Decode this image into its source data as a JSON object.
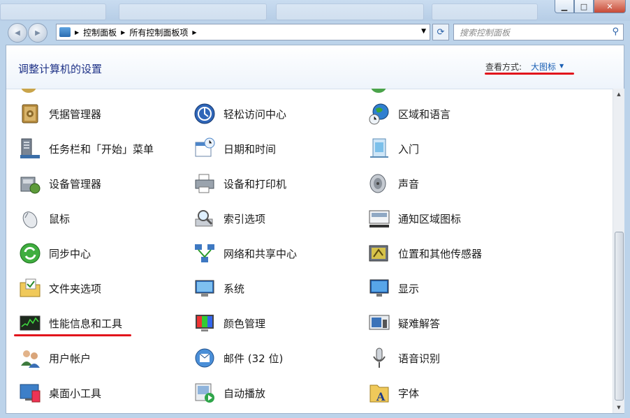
{
  "window": {
    "buttons": {
      "minimize": "▁",
      "maximize": "□",
      "close": "✕"
    }
  },
  "nav": {
    "back_icon": "◀",
    "forward_icon": "▶",
    "breadcrumb": [
      "控制面板",
      "所有控制面板项"
    ],
    "separator": "▶",
    "dropdown_icon": "▼",
    "refresh_icon": "⟳",
    "search_placeholder": "搜索控制面板",
    "search_icon": "⚲"
  },
  "header": {
    "title": "调整计算机的设置",
    "view_by_label": "查看方式:",
    "view_by_value": "大图标",
    "view_arrow": "▼"
  },
  "items": {
    "col1": [
      "凭据管理器",
      "任务栏和「开始」菜单",
      "设备管理器",
      "鼠标",
      "同步中心",
      "文件夹选项",
      "性能信息和工具",
      "用户帐户",
      "桌面小工具"
    ],
    "col2": [
      "轻松访问中心",
      "日期和时间",
      "设备和打印机",
      "索引选项",
      "网络和共享中心",
      "系统",
      "颜色管理",
      "邮件 (32 位)",
      "自动播放"
    ],
    "col3": [
      "区域和语言",
      "入门",
      "声音",
      "通知区域图标",
      "位置和其他传感器",
      "显示",
      "疑难解答",
      "语音识别",
      "字体"
    ]
  },
  "colors": {
    "accent_red": "#e2141c",
    "title_blue": "#1e3287",
    "link_blue": "#1a5fb4"
  }
}
